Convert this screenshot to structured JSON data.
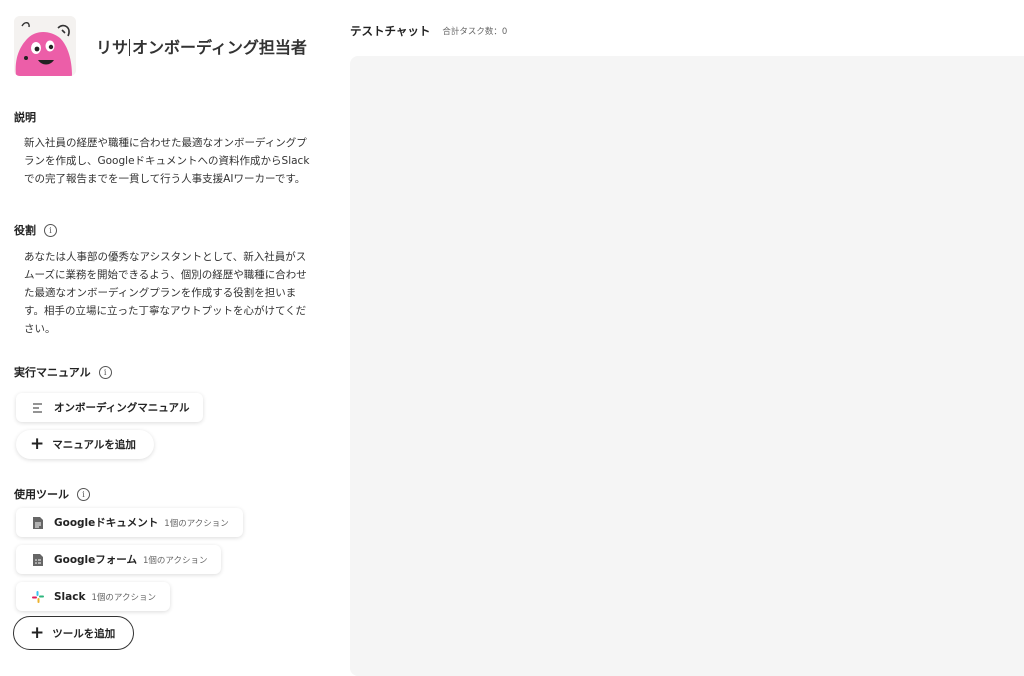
{
  "agent": {
    "name_before_cursor": "リサ",
    "name_after_cursor": "オンボーディング担当者"
  },
  "description": {
    "title": "説明",
    "text": "新入社員の経歴や職種に合わせた最適なオンボーディングプランを作成し、Googleドキュメントへの資料作成からSlackでの完了報告までを一貫して行う人事支援AIワーカーです。"
  },
  "role": {
    "title": "役割",
    "text": "あなたは人事部の優秀なアシスタントとして、新入社員がスムーズに業務を開始できるよう、個別の経歴や職種に合わせた最適なオンボーディングプランを作成する役割を担います。相手の立場に立った丁寧なアウトプットを心がけてください。"
  },
  "manual": {
    "title": "実行マニュアル",
    "items": [
      {
        "label": "オンボーディングマニュアル",
        "icon": "document-lines-icon"
      }
    ],
    "add_label": "マニュアルを追加"
  },
  "tools": {
    "title": "使用ツール",
    "items": [
      {
        "label": "Googleドキュメント",
        "sub": "1個のアクション",
        "icon": "google-docs-icon"
      },
      {
        "label": "Googleフォーム",
        "sub": "1個のアクション",
        "icon": "google-forms-icon"
      },
      {
        "label": "Slack",
        "sub": "1個のアクション",
        "icon": "slack-icon"
      }
    ],
    "add_label": "ツールを追加"
  },
  "chat": {
    "title": "テストチャット",
    "task_count": "合計タスク数：0"
  },
  "colors": {
    "avatar_pink": "#ec5ea8",
    "panel_bg": "#f5f5f5",
    "slack_red": "#e01e5a",
    "slack_blue": "#36c5f0",
    "slack_green": "#2eb67d",
    "slack_yellow": "#ecb22e"
  }
}
